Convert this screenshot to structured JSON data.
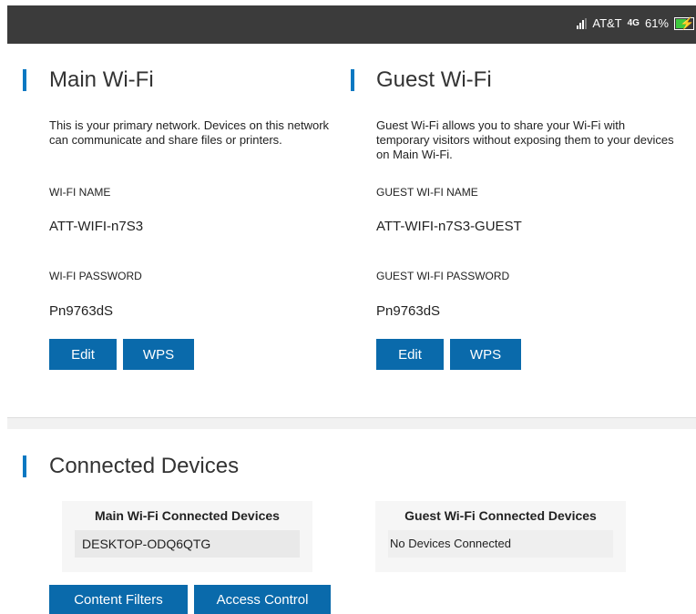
{
  "status_bar": {
    "carrier": "AT&T",
    "network": "4G",
    "battery": "61%",
    "battery_level": 0.61
  },
  "main_wifi": {
    "title": "Main Wi-Fi",
    "description": "This is your primary network. Devices on this network can communicate and share files or printers.",
    "name_label": "WI-FI NAME",
    "name_value": "ATT-WIFI-n7S3",
    "password_label": "WI-FI PASSWORD",
    "password_value": "Pn9763dS",
    "edit_label": "Edit",
    "wps_label": "WPS"
  },
  "guest_wifi": {
    "title": "Guest Wi-Fi",
    "description": "Guest Wi-Fi allows you to share your Wi-Fi with temporary visitors without exposing them to your devices on Main Wi-Fi.",
    "name_label": "GUEST WI-FI NAME",
    "name_value": "ATT-WIFI-n7S3-GUEST",
    "password_label": "GUEST WI-FI PASSWORD",
    "password_value": "Pn9763dS",
    "edit_label": "Edit",
    "wps_label": "WPS"
  },
  "connected_devices": {
    "title": "Connected Devices",
    "main_card": {
      "heading": "Main Wi-Fi Connected Devices",
      "devices": [
        "DESKTOP-ODQ6QTG"
      ]
    },
    "guest_card": {
      "heading": "Guest Wi-Fi Connected Devices",
      "empty_text": "No Devices Connected"
    },
    "content_filters_label": "Content Filters",
    "access_control_label": "Access Control"
  },
  "colors": {
    "accent": "#0a78c2",
    "button": "#0a6aab",
    "topbar": "#3b3b3b"
  }
}
